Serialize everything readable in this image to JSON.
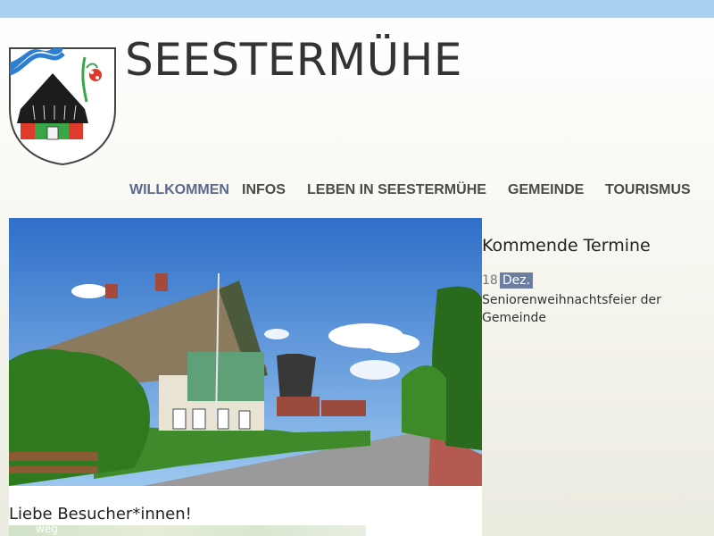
{
  "site": {
    "title": "SEESTERMÜHE"
  },
  "nav": {
    "items": [
      {
        "label": "WILLKOMMEN",
        "active": true
      },
      {
        "label": "INFOS",
        "active": false
      },
      {
        "label": "LEBEN IN SEESTERMÜHE",
        "active": false
      },
      {
        "label": "GEMEINDE",
        "active": false
      },
      {
        "label": "TOURISMUS",
        "active": false
      }
    ]
  },
  "main": {
    "welcome_heading": "Liebe Besucher*innen!",
    "map_label": "weg"
  },
  "events": {
    "title": "Kommende Termine",
    "items": [
      {
        "day": "18",
        "month": "Dez.",
        "name": "Seniorenweihnachtsfeier der Gemeinde"
      }
    ]
  },
  "colors": {
    "topbar": "#a9d2f2",
    "nav_active": "#5a6a8e",
    "nav_text": "#4b4b4b",
    "date_badge": "#6b7da1"
  }
}
